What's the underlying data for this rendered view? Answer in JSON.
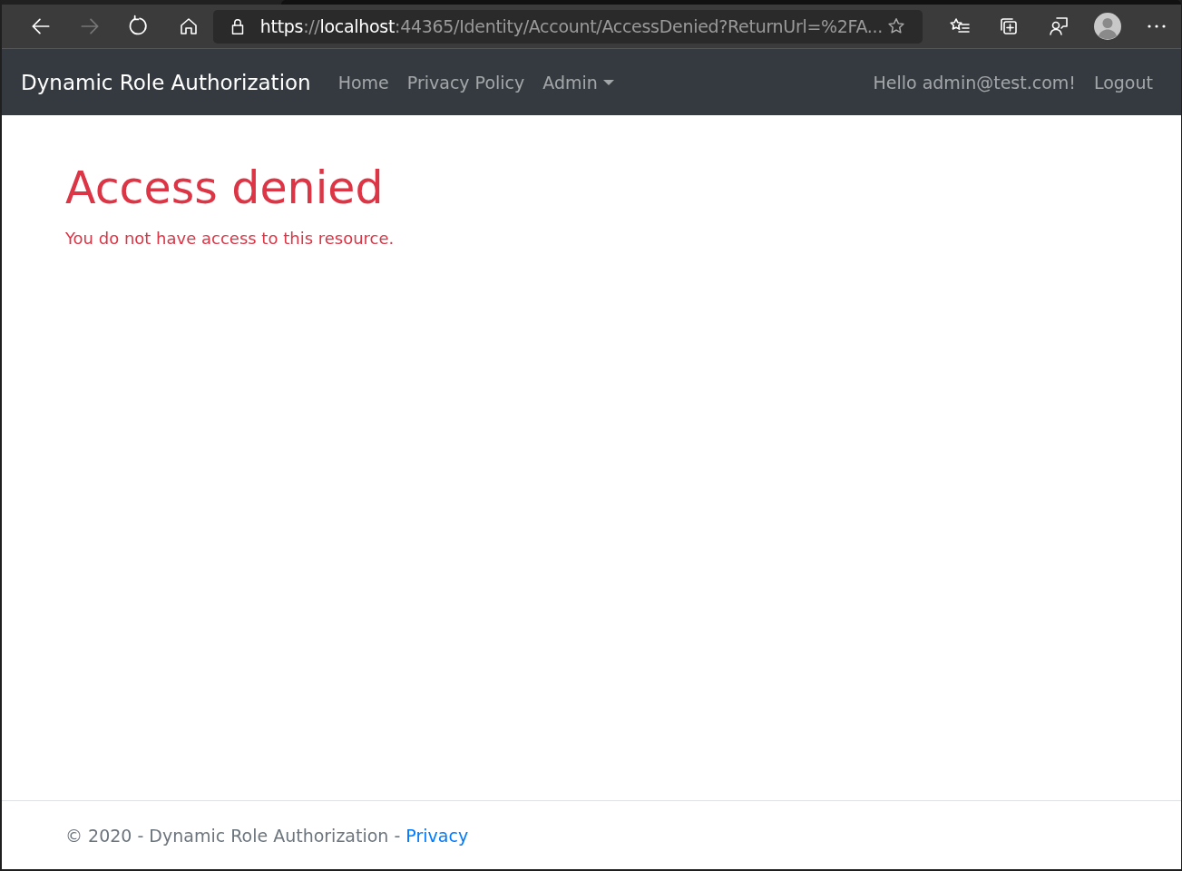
{
  "browser": {
    "url": {
      "scheme": "https",
      "separator": "://",
      "host": "localhost",
      "rest": ":44365/Identity/Account/AccessDenied?ReturnUrl=%2FA..."
    }
  },
  "navbar": {
    "brand": "Dynamic Role Authorization",
    "links": [
      {
        "label": "Home",
        "kind": "link"
      },
      {
        "label": "Privacy Policy",
        "kind": "link"
      },
      {
        "label": "Admin",
        "kind": "dropdown"
      }
    ],
    "greeting": "Hello admin@test.com!",
    "logout": "Logout"
  },
  "main": {
    "title": "Access denied",
    "message": "You do not have access to this resource."
  },
  "footer": {
    "text": "© 2020 - Dynamic Role Authorization - ",
    "link": "Privacy"
  }
}
